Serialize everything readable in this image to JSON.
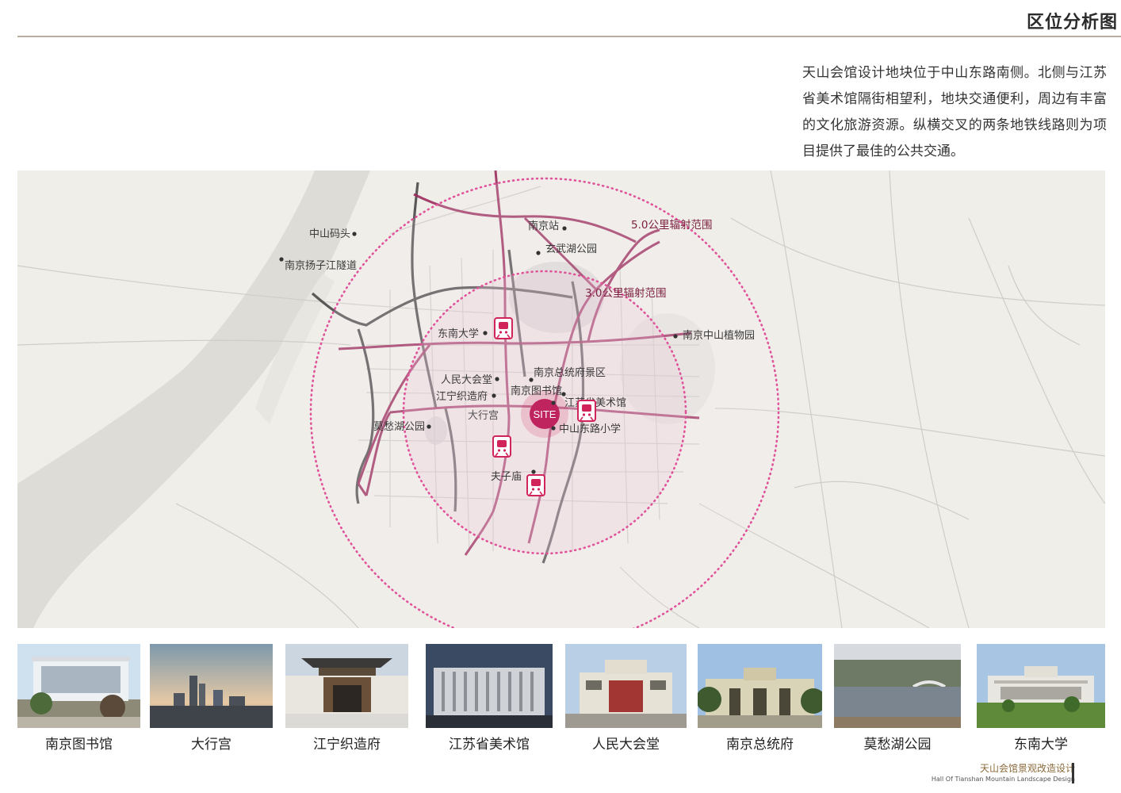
{
  "header": {
    "title": "区位分析图"
  },
  "intro": {
    "text": "天山会馆设计地块位于中山东路南侧。北侧与江苏省美术馆隔街相望利，地块交通便利，周边有丰富的文化旅游资源。纵横交叉的两条地铁线路则为项目提供了最佳的公共交通。"
  },
  "map": {
    "site_label": "SITE",
    "ring_labels": {
      "r5": "5.0公里辐射范围",
      "r3": "3.0公里辐射范围"
    },
    "places": [
      "中山码头",
      "南京扬子江隧道",
      "南京站",
      "玄武湖公园",
      "东南大学",
      "南京中山植物园",
      "南京总统府景区",
      "人民大会堂",
      "南京图书馆",
      "江宁织造府",
      "江苏省美术馆",
      "大行宫",
      "莫愁湖公园",
      "中山东路小学",
      "夫子庙"
    ],
    "colors": {
      "background": "#efeee9",
      "metro_line": "#9a2b5c",
      "highway": "#3f3f3f",
      "ring_dots": "#e0529a",
      "site": "#c0245f",
      "metro_icon": "#d0245a"
    },
    "icons": [
      "metro-icon",
      "metro-icon",
      "metro-icon",
      "metro-icon"
    ]
  },
  "photos": [
    {
      "caption": "南京图书馆"
    },
    {
      "caption": "大行宫"
    },
    {
      "caption": "江宁织造府"
    },
    {
      "caption": "江苏省美术馆"
    },
    {
      "caption": "人民大会堂"
    },
    {
      "caption": "南京总统府"
    },
    {
      "caption": "莫愁湖公园"
    },
    {
      "caption": "东南大学"
    }
  ],
  "footer": {
    "title_cn": "天山会馆景观改造设计",
    "title_en": "Hall Of Tianshan Mountain Landscape Design"
  }
}
